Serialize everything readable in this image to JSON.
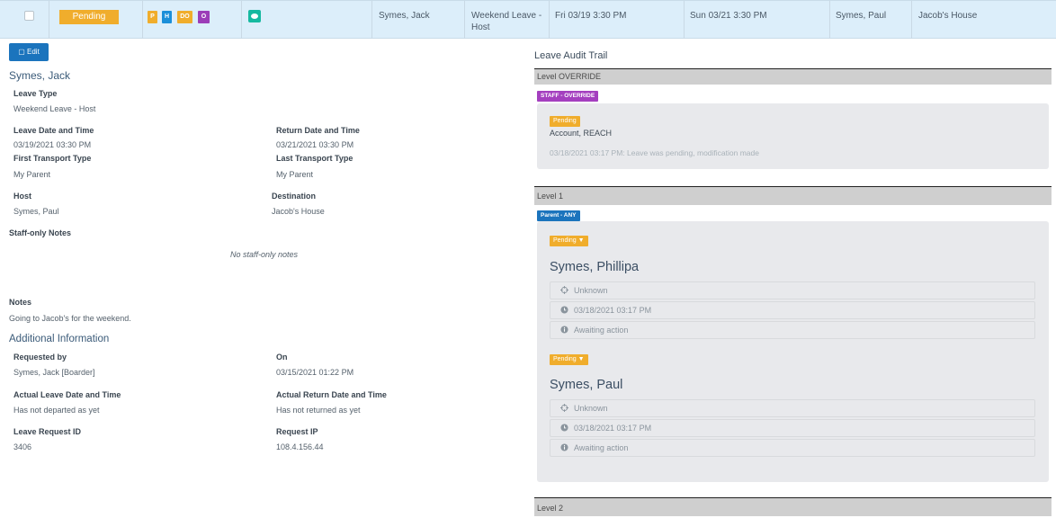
{
  "row": {
    "status": "Pending",
    "badges": [
      {
        "label": "P",
        "color": "#f0ad2c"
      },
      {
        "label": "H",
        "color": "#1b8fd9"
      },
      {
        "label": "DO",
        "color": "#f0ad2c"
      },
      {
        "label": "O",
        "color": "#9b3db8"
      }
    ],
    "chat_icon": "chat-bubble-icon",
    "student": "Symes, Jack",
    "leave_type": "Weekend Leave - Host",
    "leave_date": "Fri 03/19 3:30 PM",
    "return_date": "Sun 03/21 3:30 PM",
    "host": "Symes, Paul",
    "destination": "Jacob's House"
  },
  "detail": {
    "edit_label": "Edit",
    "name": "Symes, Jack",
    "leave_type_label": "Leave Type",
    "leave_type_value": "Weekend Leave - Host",
    "leave_dt_label": "Leave Date and Time",
    "leave_dt_value": "03/19/2021 03:30 PM",
    "return_dt_label": "Return Date and Time",
    "return_dt_value": "03/21/2021 03:30 PM",
    "first_transport_label": "First Transport Type",
    "first_transport_value": "My Parent",
    "last_transport_label": "Last Transport Type",
    "last_transport_value": "My Parent",
    "host_label": "Host",
    "host_value": "Symes, Paul",
    "destination_label": "Destination",
    "destination_value": "Jacob's House",
    "staff_notes_label": "Staff-only Notes",
    "staff_notes_value": "No staff-only notes",
    "notes_label": "Notes",
    "notes_value": "Going to Jacob's for the weekend.",
    "additional_title": "Additional Information",
    "requested_by_label": "Requested by",
    "requested_by_value": "Symes, Jack [Boarder]",
    "on_label": "On",
    "on_value": "03/15/2021 01:22 PM",
    "actual_leave_label": "Actual Leave Date and Time",
    "actual_leave_value": "Has not departed as yet",
    "actual_return_label": "Actual Return Date and Time",
    "actual_return_value": "Has not returned as yet",
    "request_id_label": "Leave Request ID",
    "request_id_value": "3406",
    "request_ip_label": "Request IP",
    "request_ip_value": "108.4.156.44"
  },
  "audit": {
    "title": "Leave Audit Trail",
    "override": {
      "level_label": "Level OVERRIDE",
      "tag": "STAFF - OVERRIDE",
      "tag_color": "#a43fbf",
      "status": "Pending",
      "account": "Account, REACH",
      "note": "03/18/2021 03:17 PM: Leave was pending, modification made"
    },
    "level1": {
      "level_label": "Level 1",
      "tag": "Parent - ANY",
      "tag_color": "#1b74bd",
      "approvers": [
        {
          "status": "Pending ▼",
          "name": "Symes, Phillipa",
          "location": "Unknown",
          "time": "03/18/2021 03:17 PM",
          "state": "Awaiting action"
        },
        {
          "status": "Pending ▼",
          "name": "Symes, Paul",
          "location": "Unknown",
          "time": "03/18/2021 03:17 PM",
          "state": "Awaiting action"
        }
      ]
    },
    "level2": {
      "level_label": "Level 2"
    }
  }
}
